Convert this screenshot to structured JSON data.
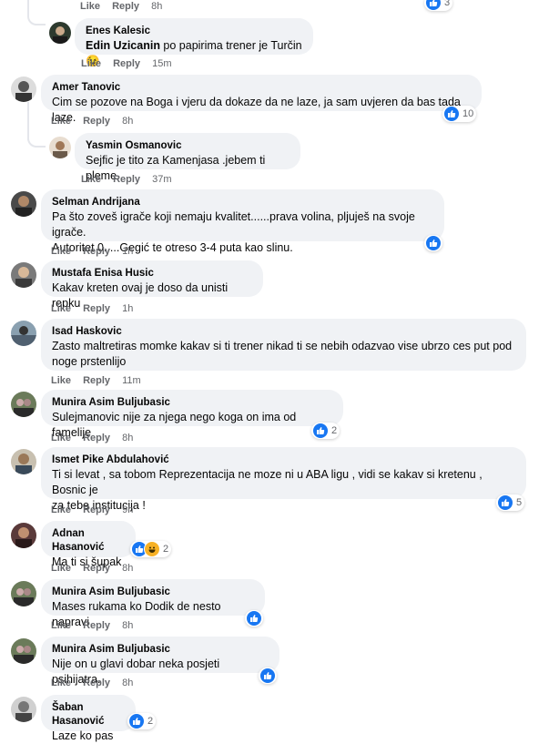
{
  "actions": {
    "like": "Like",
    "reply": "Reply"
  },
  "comments": [
    {
      "time": "8h",
      "reaction_count": "3"
    },
    {
      "author": "Enes Kalesic",
      "mention": "Edin Uzicanin",
      "text": " po papirima trener je Turčin😉",
      "time": "15m"
    },
    {
      "author": "Amer Tanovic",
      "text": "Cim se pozove na Boga i vjeru da dokaze da ne laze, ja sam uvjeren da bas tada laze.",
      "time": "8h",
      "reaction_count": "10"
    },
    {
      "author": "Yasmin Osmanovic",
      "text": "Sejfic je tito za Kamenjasa .jebem ti pleme.",
      "time": "37m"
    },
    {
      "author": "Selman Andrijana",
      "text_line1": "Pa što zoveš igrače koji nemaju kvalitet......prava volina, pljuješ na svoje igrače.",
      "text_line2": "Autoritet 0.....Gegić te otreso 3-4 puta kao slinu.",
      "time": "1h"
    },
    {
      "author": "Mustafa Enisa Husic",
      "text": "Kakav kreten ovaj je doso da unisti repku",
      "time": "1h"
    },
    {
      "author": "Isad Haskovic",
      "text_line1": "Zasto maltretiras momke kakav si ti trener nikad ti se nebih odazvao vise ubrzo ces put pod",
      "text_line2": "noge prstenlijo",
      "time": "11m"
    },
    {
      "author": "Munira Asim Buljubasic",
      "text": "Sulejmanovic nije za njega nego koga on ima od famelije",
      "time": "8h",
      "reaction_count": "2"
    },
    {
      "author": "Ismet Pike Abdulahović",
      "text_line1": "Ti si levat , sa tobom Reprezentacija ne moze ni u ABA ligu , vidi se kakav si kretenu , Bosnic je",
      "text_line2": "za tebe institucija !",
      "time": "9h",
      "reaction_count": "5"
    },
    {
      "author": "Adnan Hasanović",
      "text": "Ma ti si šupak",
      "time": "8h",
      "reaction_count": "2"
    },
    {
      "author": "Munira Asim Buljubasic",
      "text": "Mases rukama ko Dodik de nesto napravi",
      "time": "8h"
    },
    {
      "author": "Munira Asim Buljubasic",
      "text": "Nije on u glavi dobar neka posjeti psihijatra.",
      "time": "8h"
    },
    {
      "author": "Šaban Hasanović",
      "text": "Laze ko pas",
      "reaction_count": "2"
    }
  ],
  "colors": {
    "like": "#1877f2",
    "haha": "#f7b125",
    "bubble": "#f0f2f5",
    "meta": "#65676b"
  },
  "icons": {
    "like": "thumbs-up-icon",
    "haha": "haha-emoji-icon"
  }
}
